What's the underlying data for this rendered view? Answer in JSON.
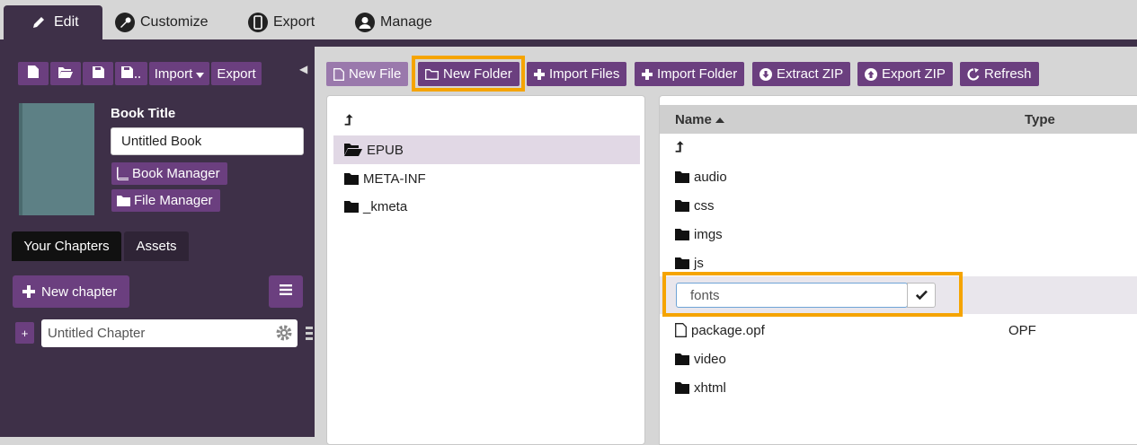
{
  "tabs": [
    {
      "label": "Edit",
      "icon": "pencil-icon",
      "active": true
    },
    {
      "label": "Customize",
      "icon": "wrench-icon"
    },
    {
      "label": "Export",
      "icon": "tablet-icon"
    },
    {
      "label": "Manage",
      "icon": "user-icon"
    }
  ],
  "sidebar": {
    "toolbar": {
      "import_label": "Import",
      "export_label": "Export"
    },
    "book_title_label": "Book Title",
    "book_title_value": "Untitled Book",
    "book_manager_label": "Book Manager",
    "file_manager_label": "File Manager",
    "chapter_tabs": [
      "Your Chapters",
      "Assets"
    ],
    "new_chapter_label": "New chapter",
    "chapters": [
      {
        "title": "Untitled Chapter"
      }
    ]
  },
  "toolbar": {
    "new_file": "New File",
    "new_folder": "New Folder",
    "import_files": "Import Files",
    "import_folder": "Import Folder",
    "extract_zip": "Extract ZIP",
    "export_zip": "Export ZIP",
    "refresh": "Refresh"
  },
  "tree": {
    "up": "⮥",
    "items": [
      {
        "name": "EPUB",
        "selected": true,
        "open": true
      },
      {
        "name": "META-INF"
      },
      {
        "name": "_kmeta"
      }
    ]
  },
  "files": {
    "columns": {
      "name": "Name",
      "type": "Type"
    },
    "rows": [
      {
        "name": "audio",
        "kind": "folder",
        "type": ""
      },
      {
        "name": "css",
        "kind": "folder",
        "type": ""
      },
      {
        "name": "imgs",
        "kind": "folder",
        "type": ""
      },
      {
        "name": "js",
        "kind": "folder",
        "type": ""
      },
      {
        "name": "package.opf",
        "kind": "file",
        "type": "OPF"
      },
      {
        "name": "video",
        "kind": "folder",
        "type": ""
      },
      {
        "name": "xhtml",
        "kind": "folder",
        "type": ""
      }
    ],
    "rename_value": "fonts"
  },
  "colors": {
    "accent": "#6b3f7f",
    "sidebar": "#3e3048",
    "highlight": "#f5a400"
  }
}
